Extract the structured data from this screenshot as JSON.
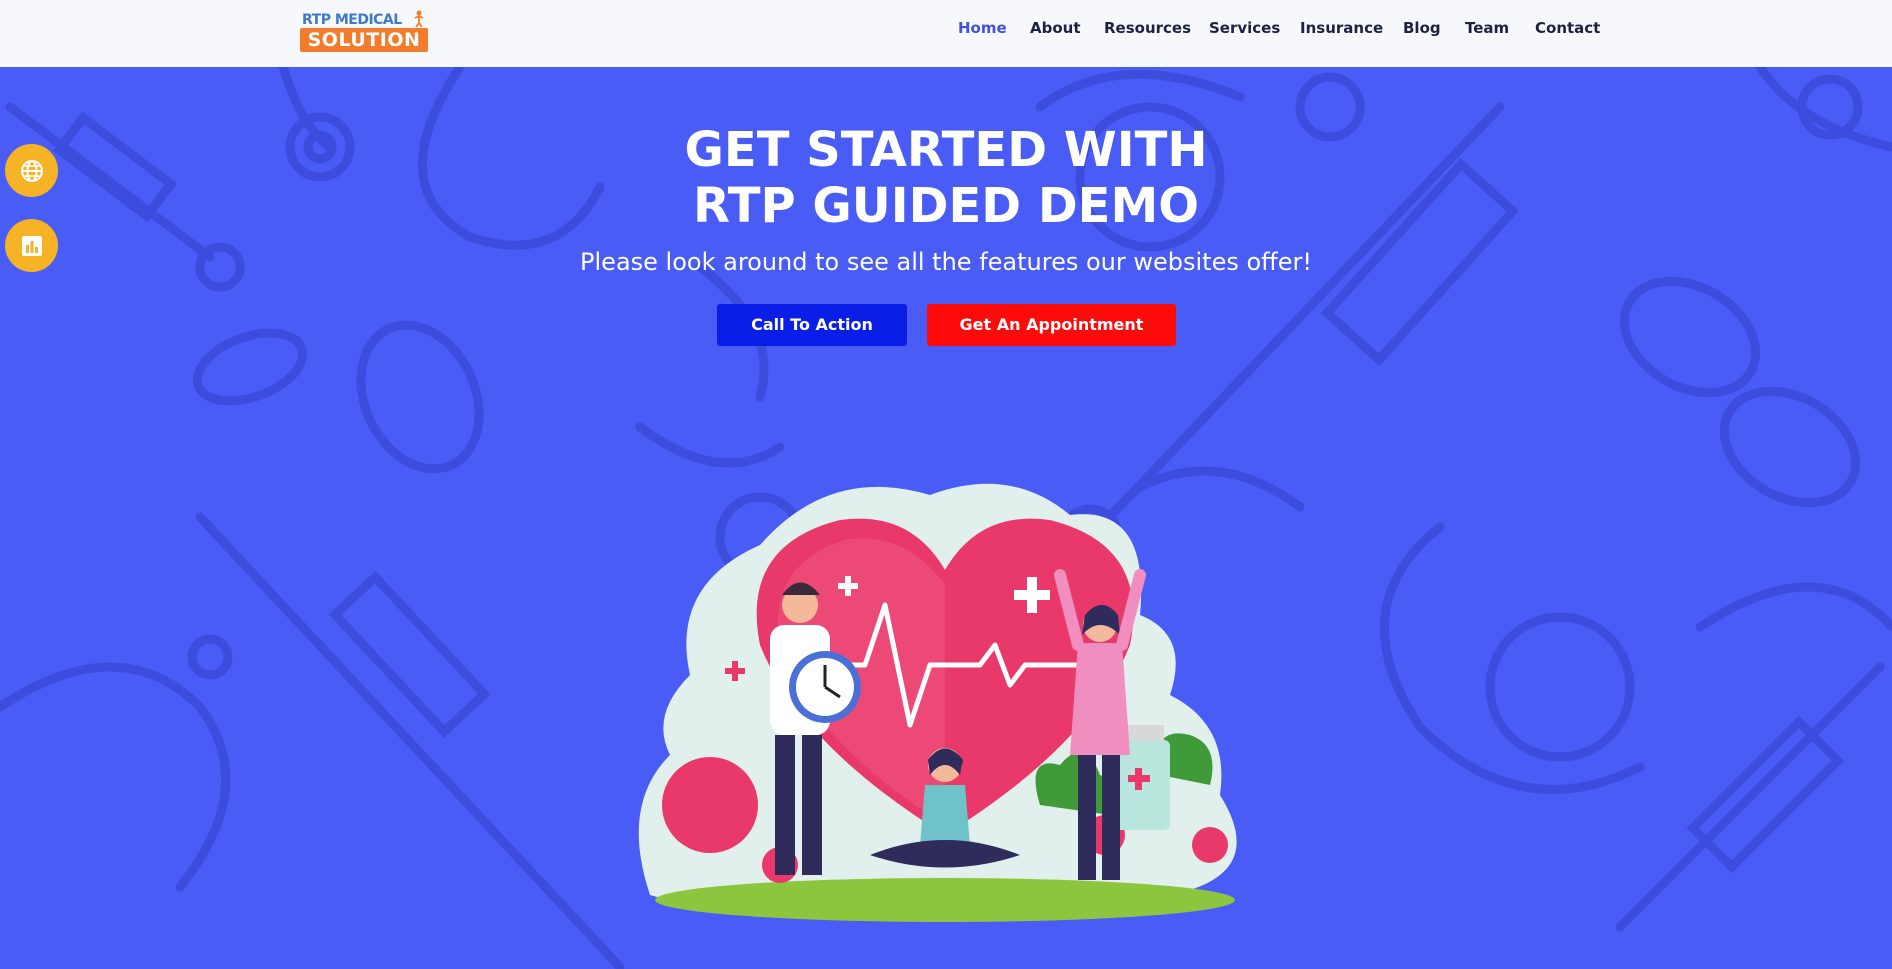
{
  "header": {
    "logo_top": "RTP MEDICAL",
    "logo_bottom": "SOLUTION",
    "nav": [
      {
        "label": "Home",
        "active": true
      },
      {
        "label": "About"
      },
      {
        "label": "Resources"
      },
      {
        "label": "Services"
      },
      {
        "label": "Insurance"
      },
      {
        "label": "Blog"
      },
      {
        "label": "Team"
      },
      {
        "label": "Contact"
      }
    ]
  },
  "side_buttons": [
    {
      "icon": "globe-icon"
    },
    {
      "icon": "bar-chart-icon"
    }
  ],
  "hero": {
    "title_line1": "GET STARTED WITH",
    "title_line2": "RTP GUIDED DEMO",
    "subtitle": "Please look around to see all the features our websites offer!",
    "cta_label": "Call To Action",
    "appointment_label": "Get An Appointment"
  },
  "colors": {
    "background": "#4a5cf6",
    "header_bg": "#f7f8fc",
    "nav_active": "#3f52e3",
    "cta_button": "#0a1ee8",
    "appointment_button": "#ff0a0a",
    "side_button": "#f5b325"
  }
}
